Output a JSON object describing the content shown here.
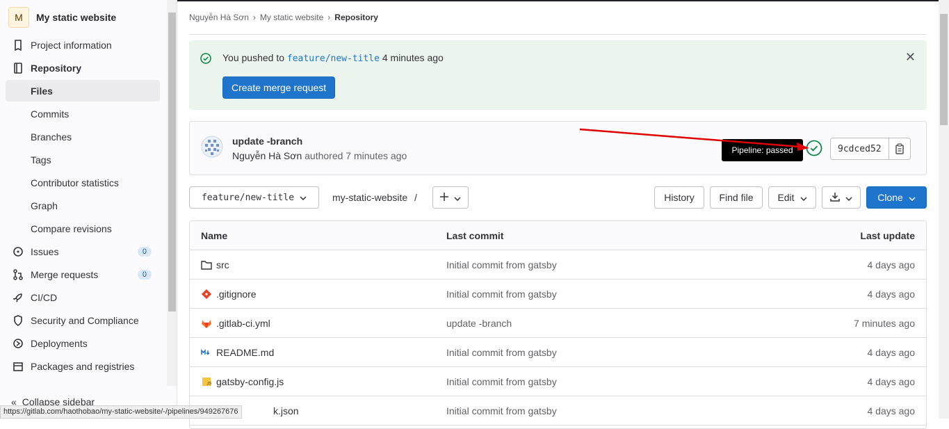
{
  "sidebar": {
    "project_initial": "M",
    "project_name": "My static website",
    "items": [
      {
        "label": "Project information"
      },
      {
        "label": "Repository"
      },
      {
        "label": "Files"
      },
      {
        "label": "Commits"
      },
      {
        "label": "Branches"
      },
      {
        "label": "Tags"
      },
      {
        "label": "Contributor statistics"
      },
      {
        "label": "Graph"
      },
      {
        "label": "Compare revisions"
      },
      {
        "label": "Issues",
        "count": "0"
      },
      {
        "label": "Merge requests",
        "count": "0"
      },
      {
        "label": "CI/CD"
      },
      {
        "label": "Security and Compliance"
      },
      {
        "label": "Deployments"
      },
      {
        "label": "Packages and registries"
      }
    ],
    "collapse_label": "Collapse sidebar"
  },
  "status_url": "https://gitlab.com/haothobao/my-static-website/-/pipelines/949267676",
  "breadcrumb": [
    "Nguyễn Hà Sơn",
    "My static website",
    "Repository"
  ],
  "alert": {
    "prefix": "You pushed to",
    "branch": "feature/new-title",
    "suffix": "4 minutes ago",
    "button": "Create merge request"
  },
  "commit": {
    "title": "update -branch",
    "author": "Nguyễn Hà Sơn",
    "authored": "authored 7 minutes ago",
    "tooltip": "Pipeline: passed",
    "sha": "9cdced52"
  },
  "toolbar": {
    "branch": "feature/new-title",
    "path": "my-static-website",
    "separator": "/",
    "history": "History",
    "find_file": "Find file",
    "edit": "Edit",
    "clone": "Clone"
  },
  "table": {
    "headers": {
      "name": "Name",
      "last_commit": "Last commit",
      "last_update": "Last update"
    },
    "rows": [
      {
        "name": "src",
        "commit": "Initial commit from gatsby",
        "date": "4 days ago"
      },
      {
        "name": ".gitignore",
        "commit": "Initial commit from gatsby",
        "date": "4 days ago"
      },
      {
        "name": ".gitlab-ci.yml",
        "commit": "update -branch",
        "date": "7 minutes ago"
      },
      {
        "name": "README.md",
        "commit": "Initial commit from gatsby",
        "date": "4 days ago"
      },
      {
        "name": "gatsby-config.js",
        "commit": "Initial commit from gatsby",
        "date": "4 days ago"
      },
      {
        "name": "k.json",
        "commit": "Initial commit from gatsby",
        "date": "4 days ago"
      }
    ]
  },
  "colors": {
    "primary": "#1f75cb",
    "success": "#108548",
    "alert_bg": "#ecf4ee",
    "annotation": "#e00000"
  }
}
